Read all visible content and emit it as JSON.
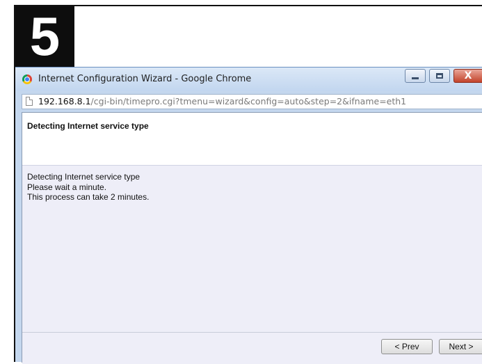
{
  "step_badge": "5",
  "window": {
    "title": "Internet Configuration Wizard - Google Chrome",
    "close_label": "X"
  },
  "address_bar": {
    "host": "192.168.8.1",
    "path": "/cgi-bin/timepro.cgi?tmenu=wizard&config=auto&step=2&ifname=eth1"
  },
  "header": {
    "title": "Detecting Internet service type"
  },
  "messages": [
    "Detecting Internet service type",
    "Please wait a minute.",
    "This process can take 2 minutes."
  ],
  "buttons": {
    "prev": "< Prev",
    "next": "Next >"
  },
  "icons": {
    "browser": "chrome-icon",
    "page": "page-icon",
    "minimize": "minimize-icon",
    "maximize": "maximize-icon",
    "close": "close-icon"
  }
}
